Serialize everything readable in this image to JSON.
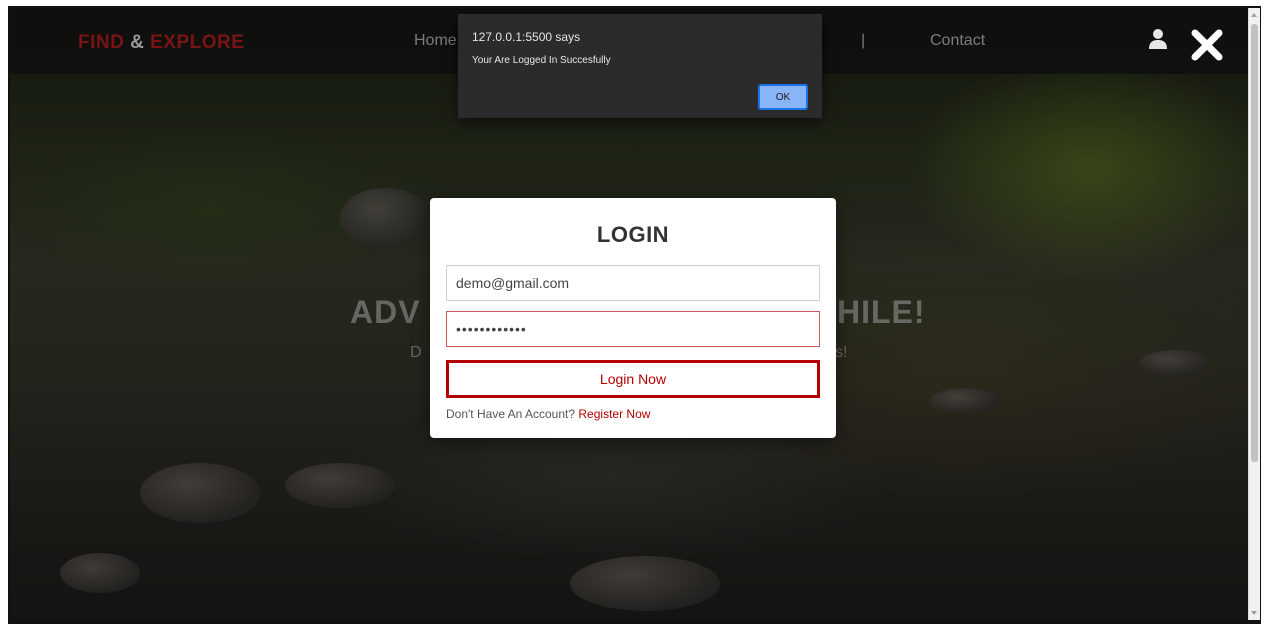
{
  "header": {
    "logo": {
      "part1": "FIND",
      "amp": "&",
      "part2": "EXPLORE"
    },
    "nav": {
      "home": "Home",
      "separator": "|",
      "contact": "Contact"
    },
    "user_icon": "user-icon",
    "close_icon": "close-icon"
  },
  "hero": {
    "title_left": "ADV",
    "title_right": "HILE!",
    "subtitle_left": "D",
    "subtitle_right": "s!"
  },
  "login": {
    "title": "LOGIN",
    "email_value": "demo@gmail.com",
    "password_value": "••••••••••••",
    "submit_label": "Login Now",
    "register_prompt": "Don't Have An Account?",
    "register_link": "Register Now"
  },
  "alert": {
    "origin": "127.0.0.1:5500 says",
    "message": "Your Are Logged In Succesfully",
    "ok_label": "OK"
  },
  "colors": {
    "accent": "#b30000",
    "alert_bg": "#2b2b2b",
    "alert_button": "#8ab4f8"
  }
}
